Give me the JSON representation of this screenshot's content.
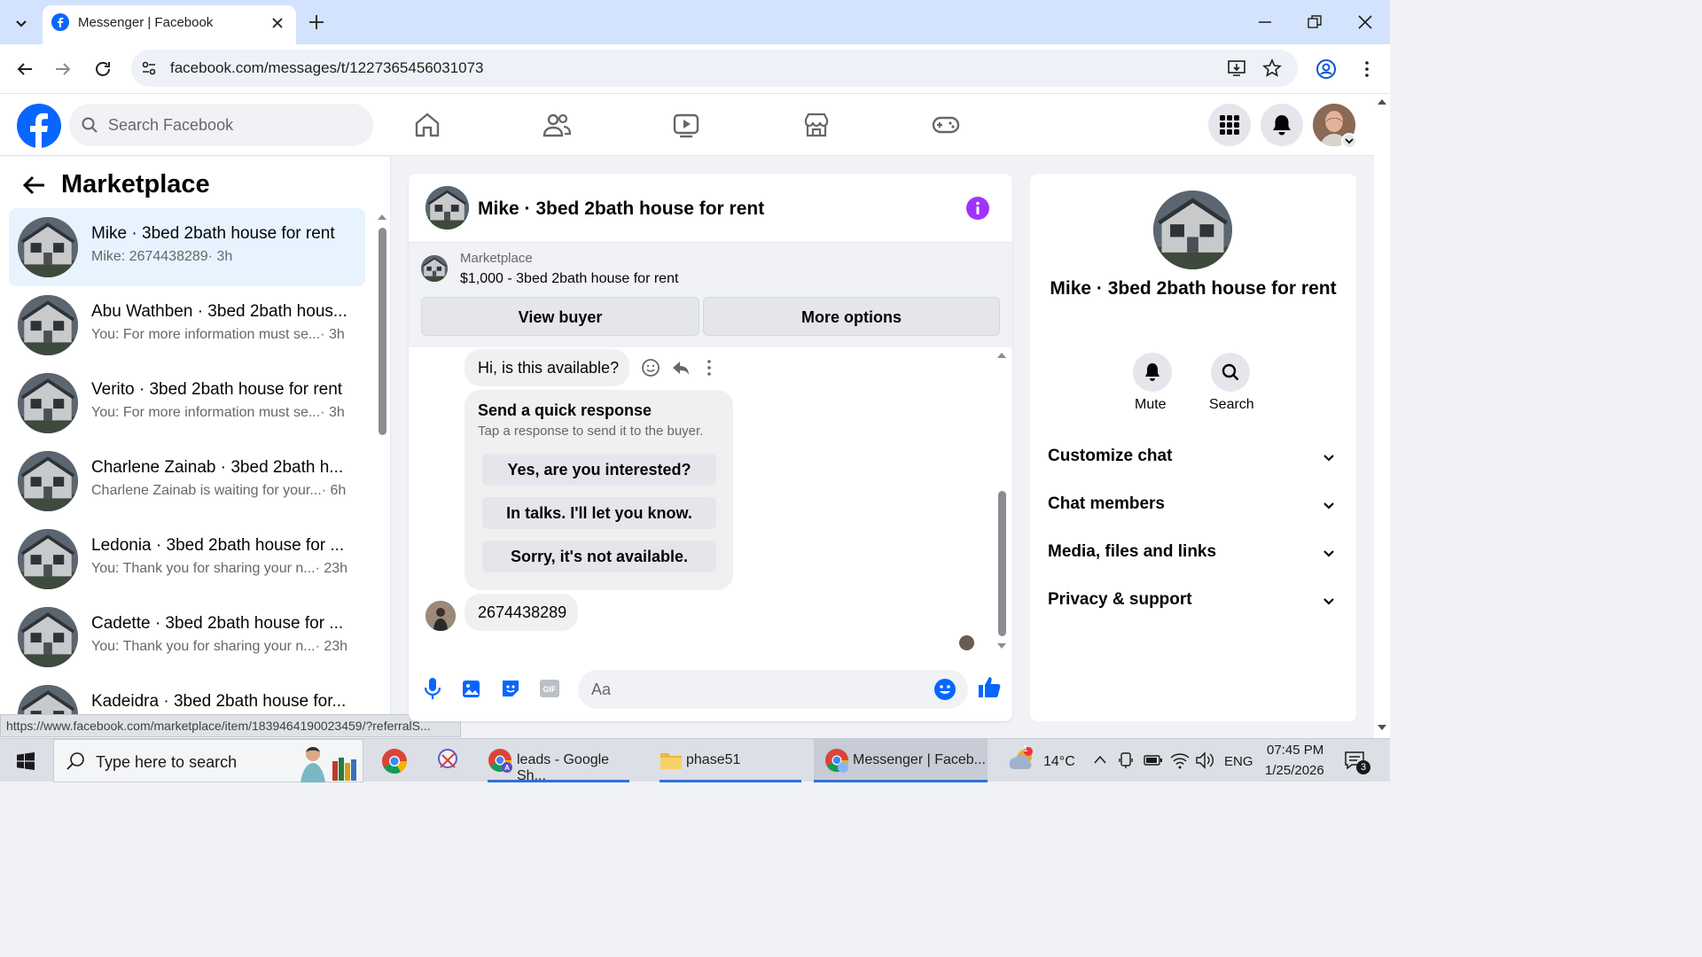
{
  "browser": {
    "tab_title": "Messenger | Facebook",
    "url": "facebook.com/messages/t/1227365456031073",
    "status_url": "https://www.facebook.com/marketplace/item/1839464190023459/?referralS..."
  },
  "fb_header": {
    "search_placeholder": "Search Facebook",
    "nav_icons": [
      "home-icon",
      "friends-icon",
      "watch-icon",
      "marketplace-icon",
      "gaming-icon"
    ],
    "right_icons": [
      "menu-grid-icon",
      "notifications-icon",
      "profile-avatar"
    ]
  },
  "sidebar": {
    "title": "Marketplace",
    "conversations": [
      {
        "title": "Mike · 3bed 2bath house for rent",
        "preview": "Mike: 2674438289",
        "time": "· 3h",
        "selected": true
      },
      {
        "title": "Abu Wathben · 3bed 2bath hous...",
        "preview": "You: For more information must se...",
        "time": "· 3h"
      },
      {
        "title": "Verito · 3bed 2bath house for rent",
        "preview": "You: For more information must se...",
        "time": "· 3h"
      },
      {
        "title": "Charlene Zainab · 3bed 2bath h...",
        "preview": "Charlene Zainab is waiting for your...",
        "time": "· 6h"
      },
      {
        "title": "Ledonia · 3bed 2bath house for ...",
        "preview": "You: Thank you for sharing your n...",
        "time": "· 23h"
      },
      {
        "title": "Cadette · 3bed 2bath house for ...",
        "preview": "You: Thank you for sharing your n...",
        "time": "· 23h"
      },
      {
        "title": "Kadeidra · 3bed 2bath house for...",
        "preview": "",
        "time": ""
      }
    ]
  },
  "chat": {
    "title": "Mike · 3bed 2bath house for rent",
    "marketplace_label": "Marketplace",
    "listing": "$1,000 - 3bed 2bath house for rent",
    "view_buyer_label": "View buyer",
    "more_options_label": "More options",
    "message_1": "Hi, is this available?",
    "quick_response_title": "Send a quick response",
    "quick_response_subtitle": "Tap a response to send it to the buyer.",
    "quick_responses": [
      "Yes, are you interested?",
      "In talks. I'll let you know.",
      "Sorry, it's not available."
    ],
    "message_2": "2674438289",
    "composer_placeholder": "Aa"
  },
  "info": {
    "name": "Mike · 3bed 2bath house for rent",
    "mute_label": "Mute",
    "search_label": "Search",
    "sections": [
      "Customize chat",
      "Chat members",
      "Media, files and links",
      "Privacy & support"
    ]
  },
  "taskbar": {
    "search_placeholder": "Type here to search",
    "apps": [
      {
        "label": "leads - Google Sh..."
      },
      {
        "label": "phase51"
      },
      {
        "label": "Messenger | Faceb..."
      }
    ],
    "weather": "14°C",
    "language": "ENG",
    "time": "07:45 PM",
    "date": "1/25/2026",
    "notification_count": "3",
    "weather_badge": "1"
  },
  "colors": {
    "fb_blue": "#0866ff",
    "selected_row": "#e7f3ff",
    "info_purple": "#a033ff",
    "tab_strip": "#d3e3fd"
  }
}
